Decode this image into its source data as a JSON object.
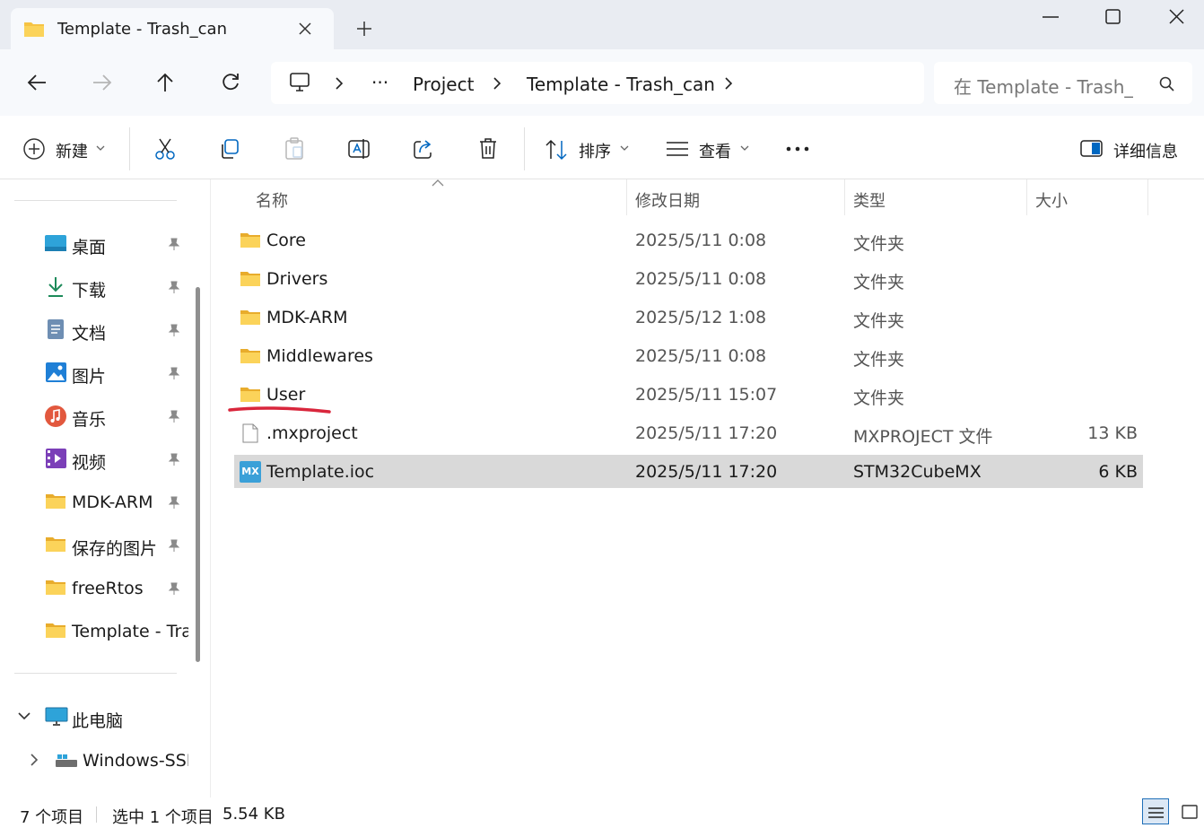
{
  "tab": {
    "title": "Template - Trash_can",
    "close_icon": "close-icon",
    "new_tab_icon": "plus-icon"
  },
  "window_controls": {
    "minimize": "minimize-icon",
    "maximize": "maximize-icon",
    "close": "close-icon"
  },
  "breadcrumb": {
    "more": "···",
    "items": [
      "Project",
      "Template - Trash_can"
    ]
  },
  "search": {
    "placeholder": "在 Template - Trash_c"
  },
  "toolbar": {
    "new_label": "新建",
    "sort_label": "排序",
    "view_label": "查看",
    "more_label": "···",
    "details_label": "详细信息"
  },
  "sidebar": {
    "quick_access": [
      {
        "label": "桌面",
        "icon": "desktop-icon"
      },
      {
        "label": "下载",
        "icon": "download-icon"
      },
      {
        "label": "文档",
        "icon": "document-icon"
      },
      {
        "label": "图片",
        "icon": "pictures-icon"
      },
      {
        "label": "音乐",
        "icon": "music-icon"
      },
      {
        "label": "视频",
        "icon": "video-icon"
      },
      {
        "label": "MDK-ARM",
        "icon": "folder-icon"
      },
      {
        "label": "保存的图片",
        "icon": "folder-icon"
      },
      {
        "label": "freeRtos",
        "icon": "folder-icon"
      },
      {
        "label": "Template - Tras",
        "icon": "folder-icon"
      }
    ],
    "this_pc": "此电脑",
    "drive": "Windows-SSD"
  },
  "columns": {
    "name": "名称",
    "date": "修改日期",
    "type": "类型",
    "size": "大小"
  },
  "files": [
    {
      "name": "Core",
      "date": "2025/5/11 0:08",
      "type": "文件夹",
      "size": "",
      "kind": "folder"
    },
    {
      "name": "Drivers",
      "date": "2025/5/11 0:08",
      "type": "文件夹",
      "size": "",
      "kind": "folder"
    },
    {
      "name": "MDK-ARM",
      "date": "2025/5/12 1:08",
      "type": "文件夹",
      "size": "",
      "kind": "folder"
    },
    {
      "name": "Middlewares",
      "date": "2025/5/11 0:08",
      "type": "文件夹",
      "size": "",
      "kind": "folder"
    },
    {
      "name": "User",
      "date": "2025/5/11 15:07",
      "type": "文件夹",
      "size": "",
      "kind": "folder"
    },
    {
      "name": ".mxproject",
      "date": "2025/5/11 17:20",
      "type": "MXPROJECT 文件",
      "size": "13 KB",
      "kind": "file"
    },
    {
      "name": "Template.ioc",
      "date": "2025/5/11 17:20",
      "type": "STM32CubeMX",
      "size": "6 KB",
      "kind": "mx",
      "mx_badge": "MX"
    }
  ],
  "status": {
    "item_count": "7 个项目",
    "selection": "选中 1 个项目",
    "selection_size": "5.54 KB"
  },
  "colors": {
    "folder": "#f6c343",
    "selection": "#d9d9d9",
    "annotation": "#d9263c",
    "accent": "#0067c0"
  }
}
